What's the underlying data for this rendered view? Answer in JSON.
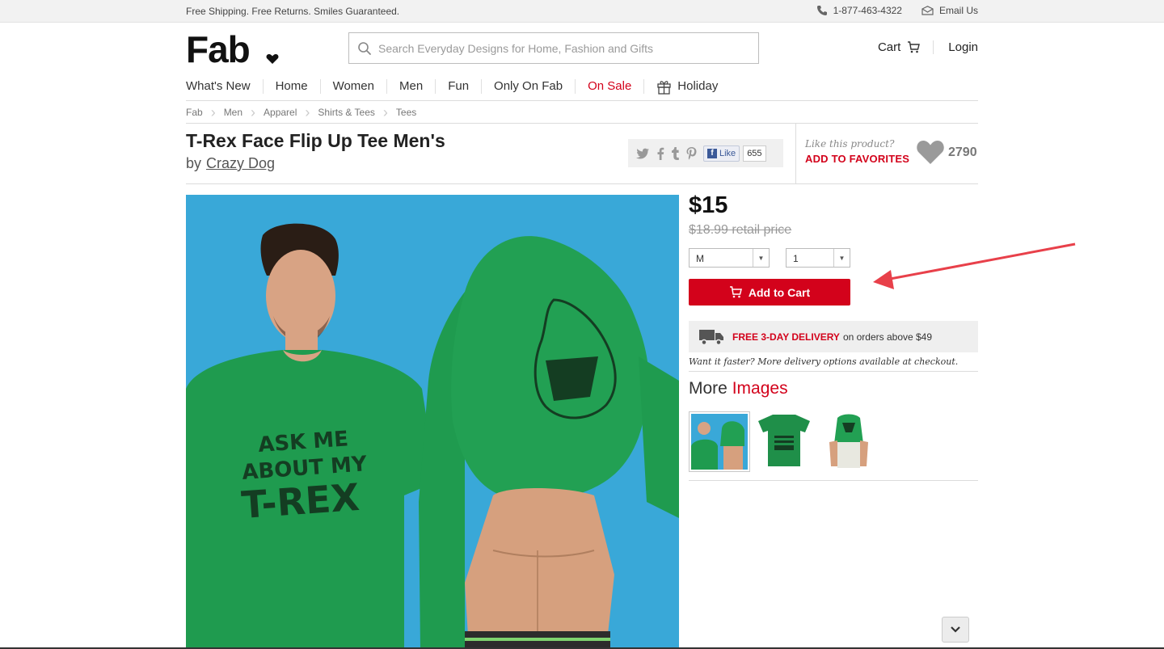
{
  "topbar": {
    "promo": "Free Shipping. Free Returns. Smiles Guaranteed.",
    "phone": "1-877-463-4322",
    "email": "Email Us"
  },
  "header": {
    "logo": "Fab",
    "search_placeholder": "Search Everyday Designs for Home, Fashion and Gifts",
    "cart_label": "Cart",
    "login_label": "Login"
  },
  "nav": {
    "items": [
      "What's New",
      "Home",
      "Women",
      "Men",
      "Fun",
      "Only On Fab",
      "On Sale",
      "Holiday"
    ]
  },
  "breadcrumb": [
    "Fab",
    "Men",
    "Apparel",
    "Shirts & Tees",
    "Tees"
  ],
  "product": {
    "title": "T-Rex Face Flip Up Tee Men's",
    "by": "by",
    "brand": "Crazy Dog",
    "price": "$15",
    "retail": "$18.99 retail price",
    "size": "M",
    "quantity": "1",
    "add_to_cart": "Add to Cart",
    "shirt_text": [
      "ASK ME",
      "ABOUT MY",
      "T-REX"
    ]
  },
  "social": {
    "like_label": "Like",
    "like_count": "655"
  },
  "favorites": {
    "question": "Like this product?",
    "cta": "ADD TO FAVORITES",
    "count": "2790"
  },
  "delivery": {
    "highlight": "FREE 3-DAY DELIVERY",
    "rest": "on orders above $49",
    "faster": "Want it faster? More delivery options available at checkout."
  },
  "more_images": {
    "prefix": "More",
    "suffix": "Images"
  },
  "colors": {
    "accent": "#d3021b",
    "photo_bg": "#39a8d8",
    "shirt": "#1f9b4f",
    "annotation_arrow": "#e8404a"
  }
}
